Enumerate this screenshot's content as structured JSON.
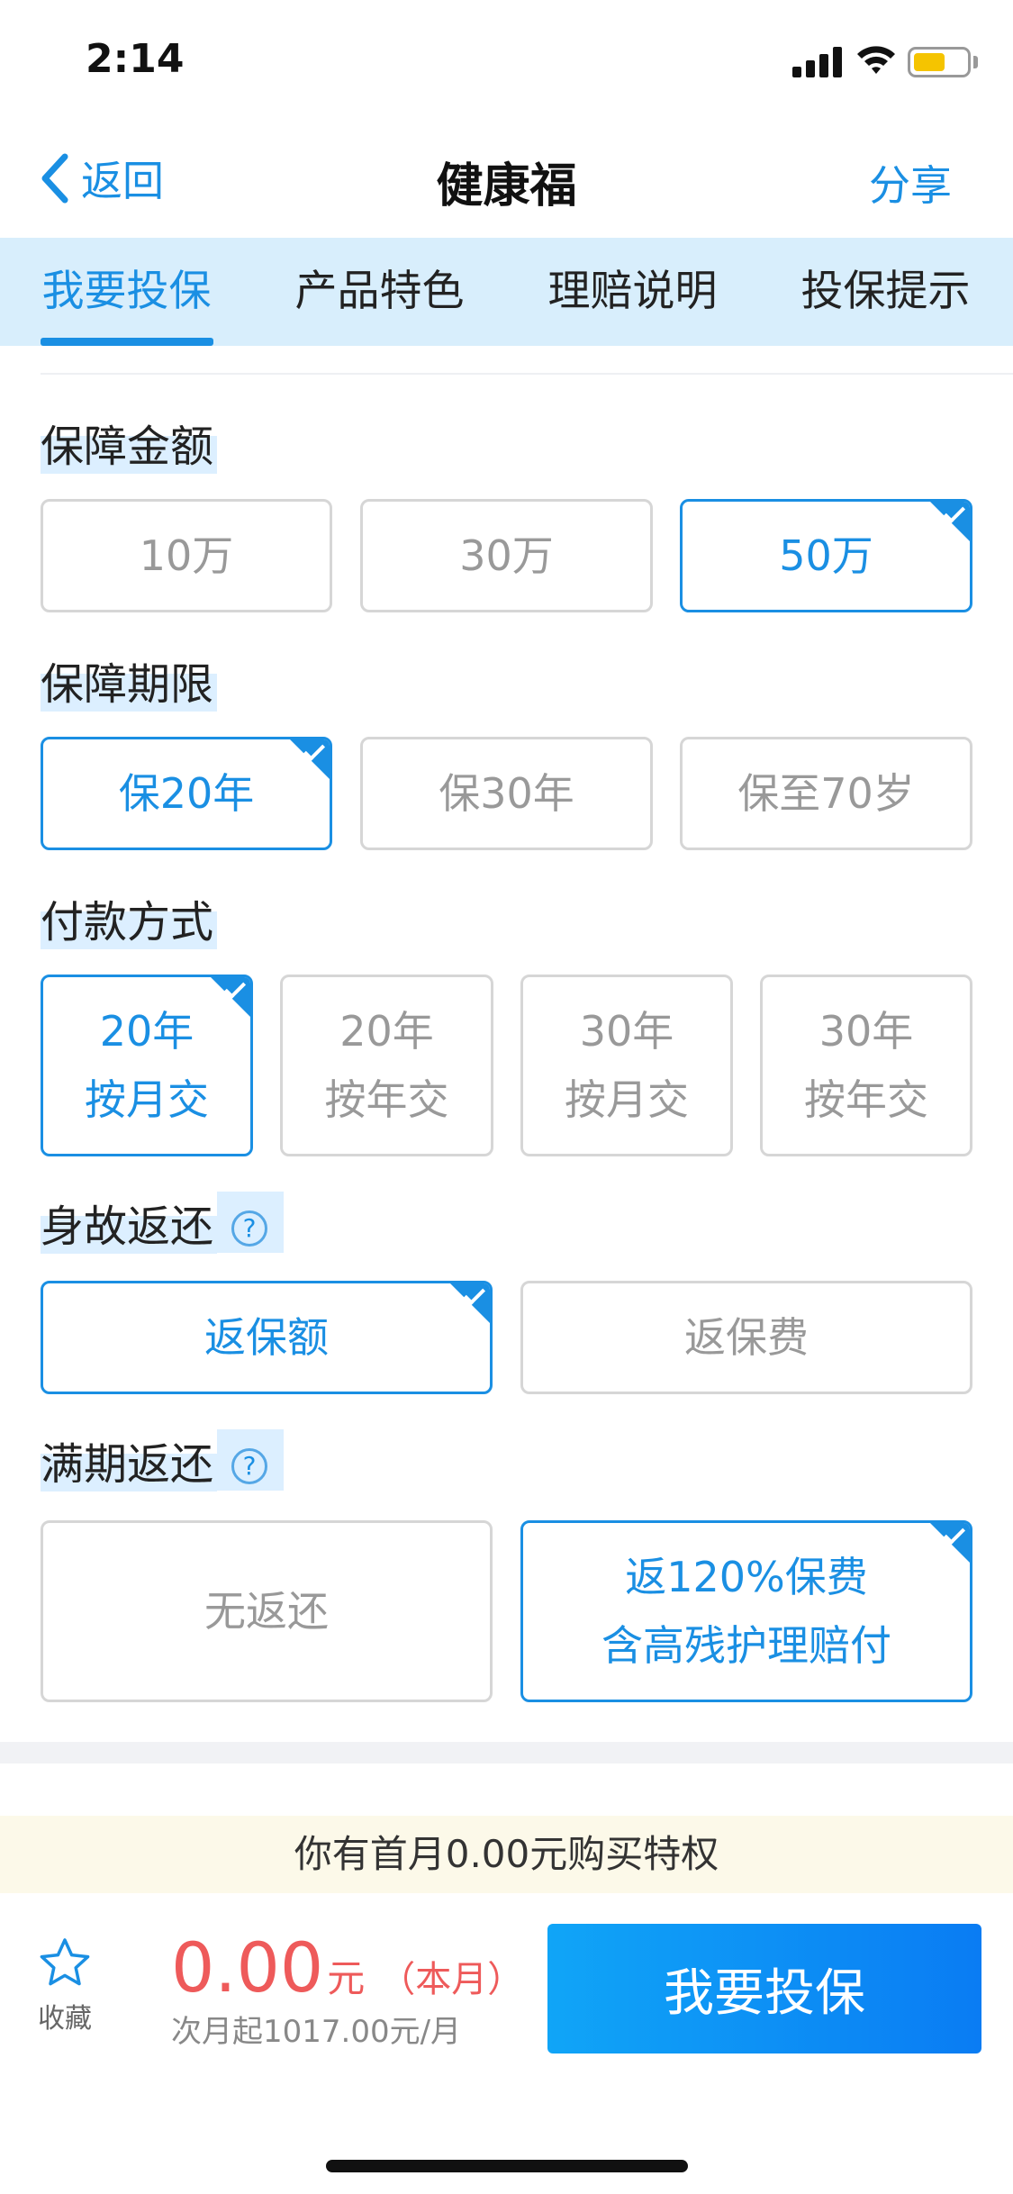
{
  "status_bar": {
    "time": "2:14",
    "battery_color": "#f5c400"
  },
  "nav": {
    "back_label": "返回",
    "title": "健康福",
    "share_label": "分享"
  },
  "tabs": [
    {
      "label": "我要投保",
      "active": true
    },
    {
      "label": "产品特色",
      "active": false
    },
    {
      "label": "理赔说明",
      "active": false
    },
    {
      "label": "投保提示",
      "active": false
    }
  ],
  "sections": {
    "coverage_amount": {
      "title": "保障金额",
      "options": [
        {
          "label": "10万",
          "selected": false
        },
        {
          "label": "30万",
          "selected": false
        },
        {
          "label": "50万",
          "selected": true
        }
      ]
    },
    "coverage_period": {
      "title": "保障期限",
      "options": [
        {
          "label": "保20年",
          "selected": true
        },
        {
          "label": "保30年",
          "selected": false
        },
        {
          "label": "保至70岁",
          "selected": false
        }
      ]
    },
    "payment_method": {
      "title": "付款方式",
      "options": [
        {
          "line1": "20年",
          "line2": "按月交",
          "selected": true
        },
        {
          "line1": "20年",
          "line2": "按年交",
          "selected": false
        },
        {
          "line1": "30年",
          "line2": "按月交",
          "selected": false
        },
        {
          "line1": "30年",
          "line2": "按年交",
          "selected": false
        }
      ]
    },
    "death_return": {
      "title": "身故返还",
      "help": "?",
      "options": [
        {
          "label": "返保额",
          "selected": true
        },
        {
          "label": "返保费",
          "selected": false
        }
      ]
    },
    "maturity_return": {
      "title": "满期返还",
      "help": "?",
      "options": [
        {
          "label": "无返还",
          "selected": false
        },
        {
          "line1": "返120%保费",
          "line2": "含高残护理赔付",
          "selected": true
        }
      ]
    }
  },
  "promo": {
    "text": "你有首月0.00元购买特权"
  },
  "footer": {
    "favorite_label": "收藏",
    "price": "0.00",
    "price_unit": "元",
    "price_note": "（本月）",
    "price_sub": "次月起1017.00元/月",
    "buy_label": "我要投保"
  },
  "colors": {
    "accent": "#1a8fe3",
    "price": "#ee5a5a",
    "tab_bg": "#d8eefc",
    "promo_bg": "#fcf9e9"
  }
}
